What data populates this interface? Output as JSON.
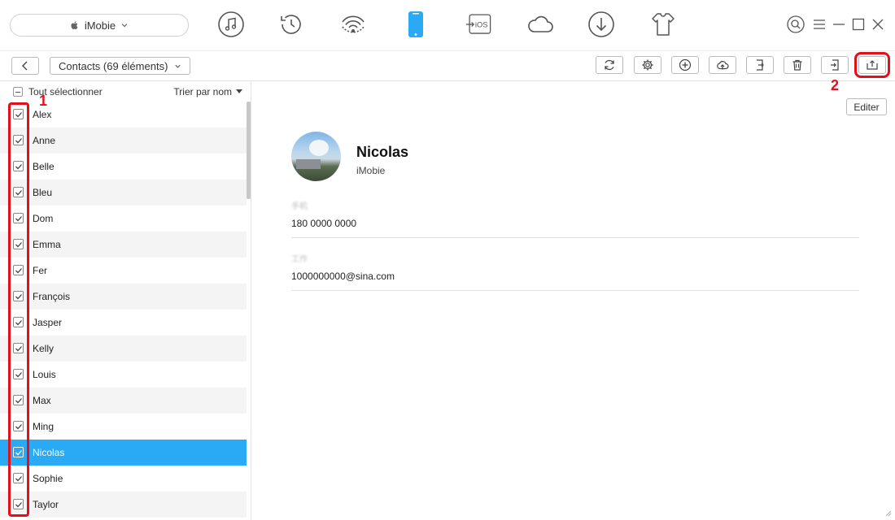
{
  "device": {
    "name": "iMobie"
  },
  "nav": {
    "icons": [
      "music-icon",
      "history-icon",
      "airdrop-icon",
      "phone-icon",
      "to-ios-icon",
      "cloud-icon",
      "download-icon",
      "tshirt-icon"
    ],
    "active": "phone-icon",
    "to_ios_label": "iOS",
    "accent": "#2aaaf4"
  },
  "toolbar": {
    "category": "Contacts (69 éléments)"
  },
  "list": {
    "select_all": "Tout sélectionner",
    "sort_label": "Trier par nom",
    "contacts": [
      "Alex",
      "Anne",
      "Belle",
      "Bleu",
      "Dom",
      "Emma",
      "Fer",
      "François",
      "Jasper",
      "Kelly",
      "Louis",
      "Max",
      "Ming",
      "Nicolas",
      "Sophie",
      "Taylor"
    ],
    "selected": "Nicolas"
  },
  "annotations": {
    "step1": "1",
    "step2": "2",
    "highlight_color": "#e3101c"
  },
  "detail": {
    "edit_label": "Editer",
    "name": "Nicolas",
    "organization": "iMobie",
    "phone_label": "手机",
    "phone": "180 0000 0000",
    "email_label": "工作",
    "email": "1000000000@sina.com"
  }
}
